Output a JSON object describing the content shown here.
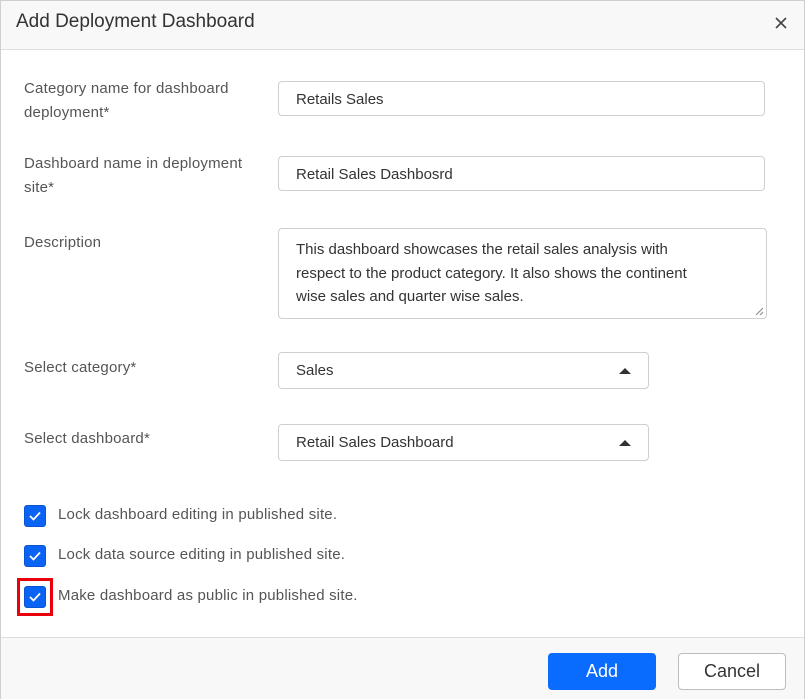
{
  "dialog": {
    "title": "Add Deployment Dashboard",
    "close_icon": "close-icon"
  },
  "form": {
    "category_name": {
      "label_line1": "Category name for dashboard",
      "label_line2": "deployment*",
      "value": "Retails Sales"
    },
    "dashboard_name": {
      "label_line1": "Dashboard name in deployment",
      "label_line2": "site*",
      "value": "Retail Sales Dashbosrd"
    },
    "description": {
      "label": "Description",
      "value": "This dashboard showcases the retail sales analysis with respect to the product category. It also shows the continent wise sales and quarter wise sales.",
      "lines": [
        "This dashboard showcases the retail sales analysis with",
        "respect to the product category. It also shows the continent",
        "wise sales and quarter wise sales."
      ]
    },
    "select_category": {
      "label": "Select category*",
      "selected": "Sales"
    },
    "select_dashboard": {
      "label": "Select dashboard*",
      "selected": "Retail Sales Dashboard"
    },
    "checkboxes": [
      {
        "label": "Lock dashboard editing in published site.",
        "checked": true
      },
      {
        "label": "Lock data source editing in published site.",
        "checked": true
      },
      {
        "label": "Make dashboard as public in published site.",
        "checked": true,
        "highlighted": true
      }
    ]
  },
  "footer": {
    "add_label": "Add",
    "cancel_label": "Cancel"
  },
  "colors": {
    "primary": "#0a6bff",
    "checkbox": "#0a63f2",
    "highlight": "#e8000b"
  }
}
